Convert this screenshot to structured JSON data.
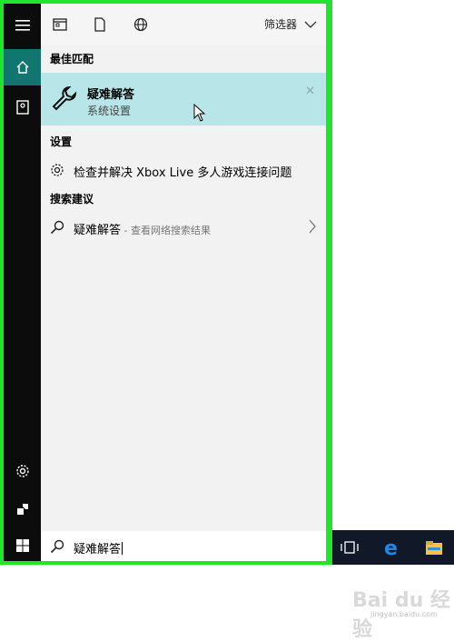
{
  "topbar": {
    "icons": [
      "news-icon",
      "document-icon",
      "globe-icon"
    ],
    "filter_label": "筛选器"
  },
  "sections": {
    "best_match": "最佳匹配",
    "settings": "设置",
    "suggestions": "搜索建议"
  },
  "best_match": {
    "title": "疑难解答",
    "subtitle": "系统设置",
    "icon": "wrench-icon"
  },
  "settings_items": [
    {
      "label": "检查并解决 Xbox Live 多人游戏连接问题",
      "icon": "gear-icon"
    }
  ],
  "suggestion_items": [
    {
      "label": "疑难解答",
      "detail": " - 查看网络搜索结果",
      "icon": "search-icon"
    }
  ],
  "search": {
    "value": "疑难解答"
  },
  "leftbar": {
    "icons": [
      "hamburger-icon",
      "home-icon",
      "notebook-icon",
      "gear-icon",
      "feedback-icon",
      "windows-start-icon"
    ]
  },
  "taskbar": {
    "icons": [
      "task-view-icon",
      "edge-icon",
      "file-explorer-icon"
    ]
  },
  "watermark": {
    "brand": "Bai du 经验",
    "url": "jingyan.baidu.com"
  },
  "colors": {
    "frame": "#21e52b",
    "accent": "#10766f",
    "highlight": "#b8e6e8"
  }
}
